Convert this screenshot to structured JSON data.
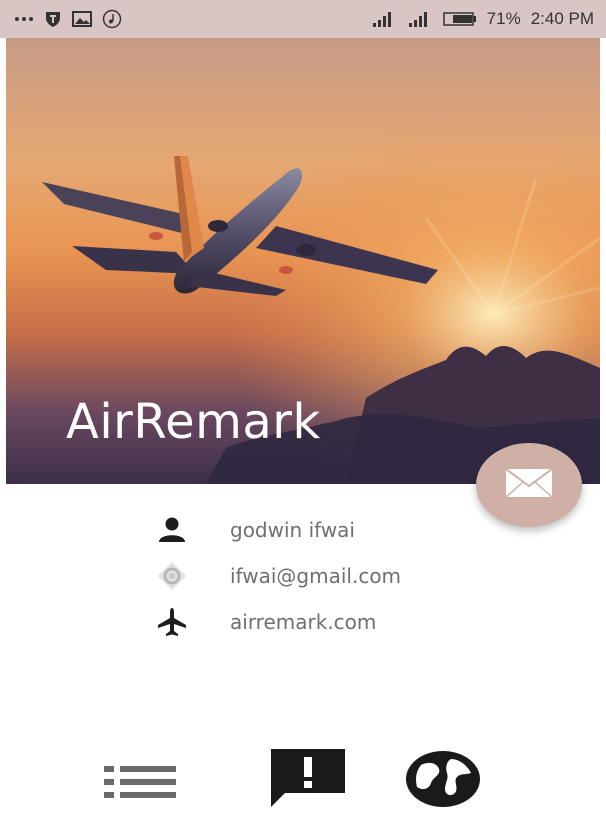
{
  "status_bar": {
    "left_icons": [
      "more-dots-icon",
      "shield-icon",
      "image-icon",
      "music-icon"
    ],
    "right_icons": [
      "signal-icon",
      "signal-icon",
      "battery-icon"
    ],
    "battery": "71%",
    "time": "2:40 PM"
  },
  "hero": {
    "title": "AirRemark"
  },
  "fab": {
    "icon": "mail-icon"
  },
  "profile": {
    "name": "godwin ifwai",
    "email": "ifwai@gmail.com",
    "website": "airremark.com",
    "icons": [
      "person-icon",
      "location-icon",
      "airplane-icon"
    ]
  },
  "bottom_nav": {
    "items": [
      "list-icon",
      "feedback-icon",
      "globe-icon"
    ]
  }
}
